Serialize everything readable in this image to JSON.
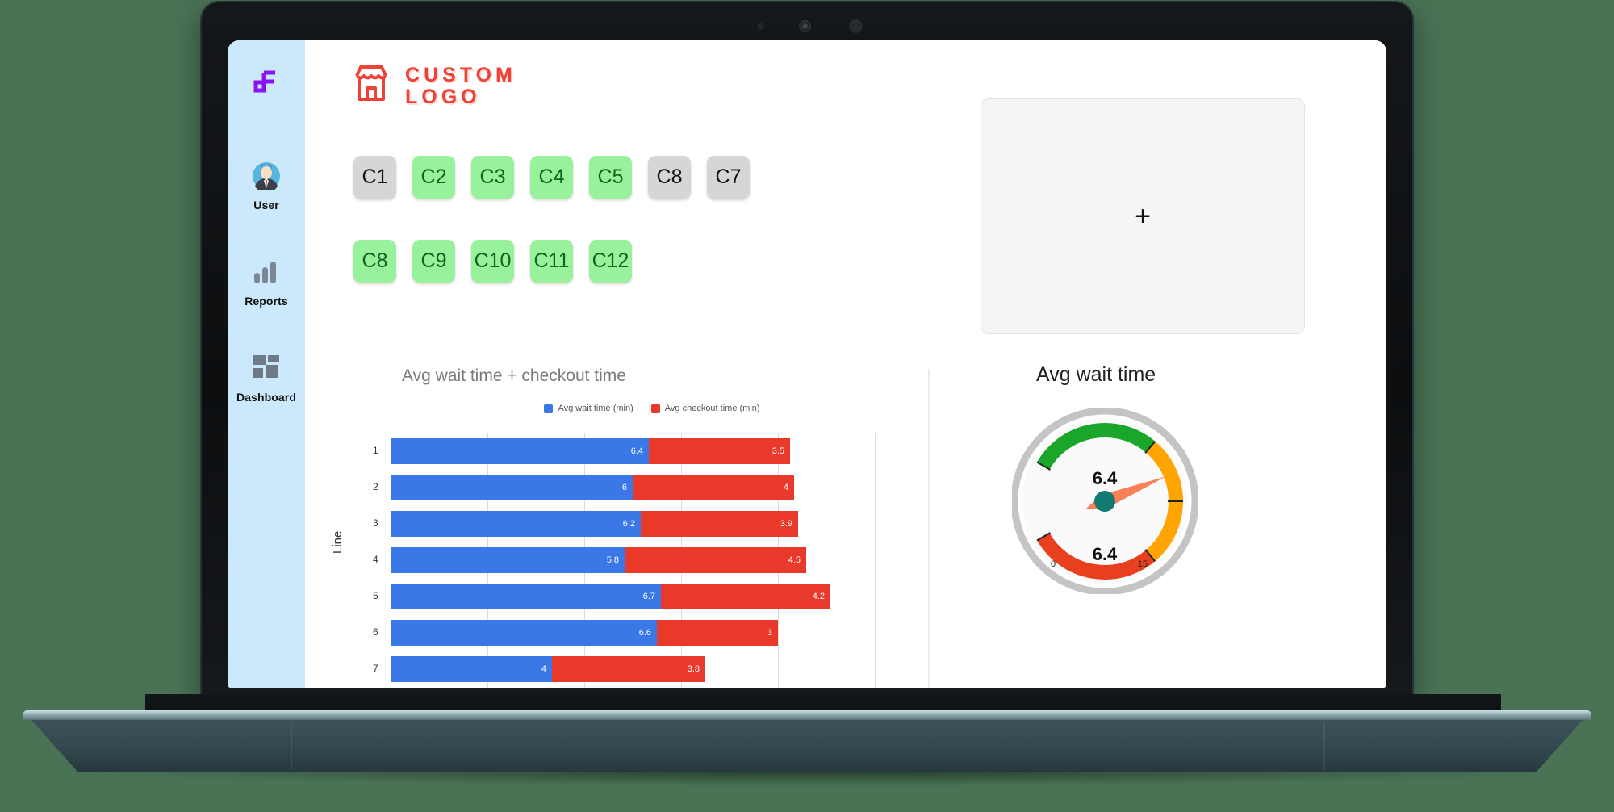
{
  "app": {
    "sidebar": {
      "brand_icon": "purple-geometric-logo-icon",
      "items": [
        {
          "label": "User",
          "icon": "user-avatar-icon"
        },
        {
          "label": "Reports",
          "icon": "bar-chart-icon"
        },
        {
          "label": "Dashboard",
          "icon": "dashboard-grid-icon"
        }
      ]
    },
    "header": {
      "logo_icon": "storefront-icon",
      "logo_line1": "CUSTOM",
      "logo_line2": "LOGO"
    },
    "chips": {
      "row1": [
        {
          "label": "C1",
          "state": "gray"
        },
        {
          "label": "C2",
          "state": "green"
        },
        {
          "label": "C3",
          "state": "green"
        },
        {
          "label": "C4",
          "state": "green"
        },
        {
          "label": "C5",
          "state": "green"
        },
        {
          "label": "C8",
          "state": "gray"
        },
        {
          "label": "C7",
          "state": "gray"
        }
      ],
      "row2": [
        {
          "label": "C8",
          "state": "green"
        },
        {
          "label": "C9",
          "state": "green"
        },
        {
          "label": "C10",
          "state": "green"
        },
        {
          "label": "C11",
          "state": "green"
        },
        {
          "label": "C12",
          "state": "green"
        }
      ]
    },
    "placeholder_card": {
      "add_icon": "plus-icon",
      "add_label": "+"
    }
  },
  "colors": {
    "sidebar_bg": "#cbe9fb",
    "brand_red": "#ef4136",
    "chip_green": "#97f29b",
    "chip_gray": "#d6d6d6",
    "series_blue": "#3b78e7",
    "series_red": "#e8392b",
    "gauge_green": "#1aa62a",
    "gauge_orange": "#ffa400",
    "gauge_red": "#e8401f",
    "gauge_hub": "#137a72",
    "gauge_needle": "#fa8057"
  },
  "chart_data": [
    {
      "type": "bar",
      "orientation": "horizontal",
      "stacked": true,
      "title": "Avg wait time + checkout time",
      "xlabel": "",
      "ylabel": "Line",
      "categories": [
        "1",
        "2",
        "3",
        "4",
        "5",
        "6",
        "7"
      ],
      "series": [
        {
          "name": "Avg wait time (min)",
          "color": "#3b78e7",
          "values": [
            6.4,
            6,
            6.2,
            5.8,
            6.7,
            6.6,
            4
          ]
        },
        {
          "name": "Avg checkout time (min)",
          "color": "#e8392b",
          "values": [
            3.5,
            4,
            3.9,
            4.5,
            4.2,
            3,
            3.8
          ]
        }
      ],
      "xlim": [
        0,
        12
      ],
      "grid": true,
      "legend_position": "top-center",
      "data_labels": true
    },
    {
      "type": "gauge",
      "title": "Avg wait time",
      "value": 6.4,
      "value_label": "6.4",
      "min": 0,
      "max": 15,
      "min_label": "0",
      "max_label": "15",
      "bands": [
        {
          "from": 0,
          "to": 5,
          "color": "#1aa62a"
        },
        {
          "from": 5,
          "to": 10,
          "color": "#ffa400"
        },
        {
          "from": 10,
          "to": 15,
          "color": "#e8401f"
        }
      ]
    }
  ]
}
